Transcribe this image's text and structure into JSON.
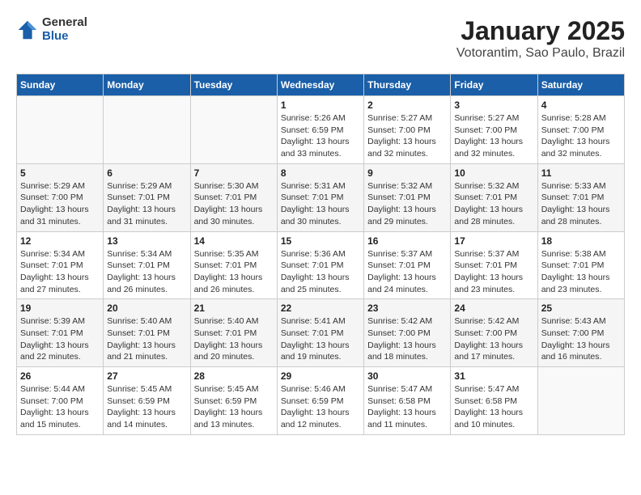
{
  "header": {
    "logo": {
      "general": "General",
      "blue": "Blue"
    },
    "title": "January 2025",
    "subtitle": "Votorantim, Sao Paulo, Brazil"
  },
  "weekdays": [
    "Sunday",
    "Monday",
    "Tuesday",
    "Wednesday",
    "Thursday",
    "Friday",
    "Saturday"
  ],
  "weeks": [
    [
      {
        "day": "",
        "info": ""
      },
      {
        "day": "",
        "info": ""
      },
      {
        "day": "",
        "info": ""
      },
      {
        "day": "1",
        "info": "Sunrise: 5:26 AM\nSunset: 6:59 PM\nDaylight: 13 hours\nand 33 minutes."
      },
      {
        "day": "2",
        "info": "Sunrise: 5:27 AM\nSunset: 7:00 PM\nDaylight: 13 hours\nand 32 minutes."
      },
      {
        "day": "3",
        "info": "Sunrise: 5:27 AM\nSunset: 7:00 PM\nDaylight: 13 hours\nand 32 minutes."
      },
      {
        "day": "4",
        "info": "Sunrise: 5:28 AM\nSunset: 7:00 PM\nDaylight: 13 hours\nand 32 minutes."
      }
    ],
    [
      {
        "day": "5",
        "info": "Sunrise: 5:29 AM\nSunset: 7:00 PM\nDaylight: 13 hours\nand 31 minutes."
      },
      {
        "day": "6",
        "info": "Sunrise: 5:29 AM\nSunset: 7:01 PM\nDaylight: 13 hours\nand 31 minutes."
      },
      {
        "day": "7",
        "info": "Sunrise: 5:30 AM\nSunset: 7:01 PM\nDaylight: 13 hours\nand 30 minutes."
      },
      {
        "day": "8",
        "info": "Sunrise: 5:31 AM\nSunset: 7:01 PM\nDaylight: 13 hours\nand 30 minutes."
      },
      {
        "day": "9",
        "info": "Sunrise: 5:32 AM\nSunset: 7:01 PM\nDaylight: 13 hours\nand 29 minutes."
      },
      {
        "day": "10",
        "info": "Sunrise: 5:32 AM\nSunset: 7:01 PM\nDaylight: 13 hours\nand 28 minutes."
      },
      {
        "day": "11",
        "info": "Sunrise: 5:33 AM\nSunset: 7:01 PM\nDaylight: 13 hours\nand 28 minutes."
      }
    ],
    [
      {
        "day": "12",
        "info": "Sunrise: 5:34 AM\nSunset: 7:01 PM\nDaylight: 13 hours\nand 27 minutes."
      },
      {
        "day": "13",
        "info": "Sunrise: 5:34 AM\nSunset: 7:01 PM\nDaylight: 13 hours\nand 26 minutes."
      },
      {
        "day": "14",
        "info": "Sunrise: 5:35 AM\nSunset: 7:01 PM\nDaylight: 13 hours\nand 26 minutes."
      },
      {
        "day": "15",
        "info": "Sunrise: 5:36 AM\nSunset: 7:01 PM\nDaylight: 13 hours\nand 25 minutes."
      },
      {
        "day": "16",
        "info": "Sunrise: 5:37 AM\nSunset: 7:01 PM\nDaylight: 13 hours\nand 24 minutes."
      },
      {
        "day": "17",
        "info": "Sunrise: 5:37 AM\nSunset: 7:01 PM\nDaylight: 13 hours\nand 23 minutes."
      },
      {
        "day": "18",
        "info": "Sunrise: 5:38 AM\nSunset: 7:01 PM\nDaylight: 13 hours\nand 23 minutes."
      }
    ],
    [
      {
        "day": "19",
        "info": "Sunrise: 5:39 AM\nSunset: 7:01 PM\nDaylight: 13 hours\nand 22 minutes."
      },
      {
        "day": "20",
        "info": "Sunrise: 5:40 AM\nSunset: 7:01 PM\nDaylight: 13 hours\nand 21 minutes."
      },
      {
        "day": "21",
        "info": "Sunrise: 5:40 AM\nSunset: 7:01 PM\nDaylight: 13 hours\nand 20 minutes."
      },
      {
        "day": "22",
        "info": "Sunrise: 5:41 AM\nSunset: 7:01 PM\nDaylight: 13 hours\nand 19 minutes."
      },
      {
        "day": "23",
        "info": "Sunrise: 5:42 AM\nSunset: 7:00 PM\nDaylight: 13 hours\nand 18 minutes."
      },
      {
        "day": "24",
        "info": "Sunrise: 5:42 AM\nSunset: 7:00 PM\nDaylight: 13 hours\nand 17 minutes."
      },
      {
        "day": "25",
        "info": "Sunrise: 5:43 AM\nSunset: 7:00 PM\nDaylight: 13 hours\nand 16 minutes."
      }
    ],
    [
      {
        "day": "26",
        "info": "Sunrise: 5:44 AM\nSunset: 7:00 PM\nDaylight: 13 hours\nand 15 minutes."
      },
      {
        "day": "27",
        "info": "Sunrise: 5:45 AM\nSunset: 6:59 PM\nDaylight: 13 hours\nand 14 minutes."
      },
      {
        "day": "28",
        "info": "Sunrise: 5:45 AM\nSunset: 6:59 PM\nDaylight: 13 hours\nand 13 minutes."
      },
      {
        "day": "29",
        "info": "Sunrise: 5:46 AM\nSunset: 6:59 PM\nDaylight: 13 hours\nand 12 minutes."
      },
      {
        "day": "30",
        "info": "Sunrise: 5:47 AM\nSunset: 6:58 PM\nDaylight: 13 hours\nand 11 minutes."
      },
      {
        "day": "31",
        "info": "Sunrise: 5:47 AM\nSunset: 6:58 PM\nDaylight: 13 hours\nand 10 minutes."
      },
      {
        "day": "",
        "info": ""
      }
    ]
  ]
}
